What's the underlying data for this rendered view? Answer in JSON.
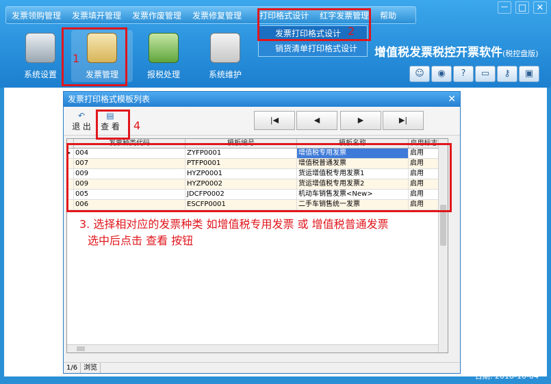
{
  "menu": [
    "发票领购管理",
    "发票填开管理",
    "发票作废管理",
    "发票修复管理",
    "打印格式设计",
    "红字发票管理",
    "帮助"
  ],
  "window_controls": [
    "－",
    "□",
    "✕"
  ],
  "dropdown": [
    "发票打印格式设计",
    "销货清单打印格式设计"
  ],
  "tools": [
    {
      "label": "系统设置",
      "icon": "settings-icon"
    },
    {
      "label": "发票管理",
      "icon": "invoice-icon"
    },
    {
      "label": "报税处理",
      "icon": "tax-report-icon"
    },
    {
      "label": "系统维护",
      "icon": "maintenance-icon"
    }
  ],
  "brand": {
    "title": "增值税发票税控开票软件",
    "subtitle": "(税控盘版)"
  },
  "right_icons": [
    "user-icon",
    "globe-icon",
    "help-icon",
    "window-icon",
    "key-icon",
    "lock-icon"
  ],
  "dialog": {
    "title": "发票打印格式模板列表",
    "close": "✕",
    "exit_label": "退 出",
    "view_label": "查 看",
    "nav": [
      "|◀",
      "◀",
      "▶",
      "▶|"
    ],
    "columns": [
      "发票种类代码",
      "模板编号",
      "模板名称",
      "启用标志"
    ],
    "rows": [
      [
        "004",
        "ZYFP0001",
        "增值税专用发票",
        "启用"
      ],
      [
        "007",
        "PTFP0001",
        "增值税普通发票",
        "启用"
      ],
      [
        "009",
        "HYZP0001",
        "货运增值税专用发票1",
        "启用"
      ],
      [
        "009",
        "HYZP0002",
        "货运增值税专用发票2",
        "启用"
      ],
      [
        "005",
        "JDCFP0002",
        "机动车销售发票<New>",
        "启用"
      ],
      [
        "006",
        "ESCFP0001",
        "二手车销售统一发票",
        "启用"
      ]
    ],
    "status_page": "1/6",
    "status_mode": "浏览"
  },
  "annotations": {
    "n1": "1",
    "n2": "2",
    "n4": "4",
    "line1": "3. 选择相对应的发票种类 如增值税专用发票 或 增值税普通发票",
    "line2": "选中后点击 查看 按钮",
    "color": "#e0161c"
  },
  "status_date": "日期: 2018-10-04"
}
